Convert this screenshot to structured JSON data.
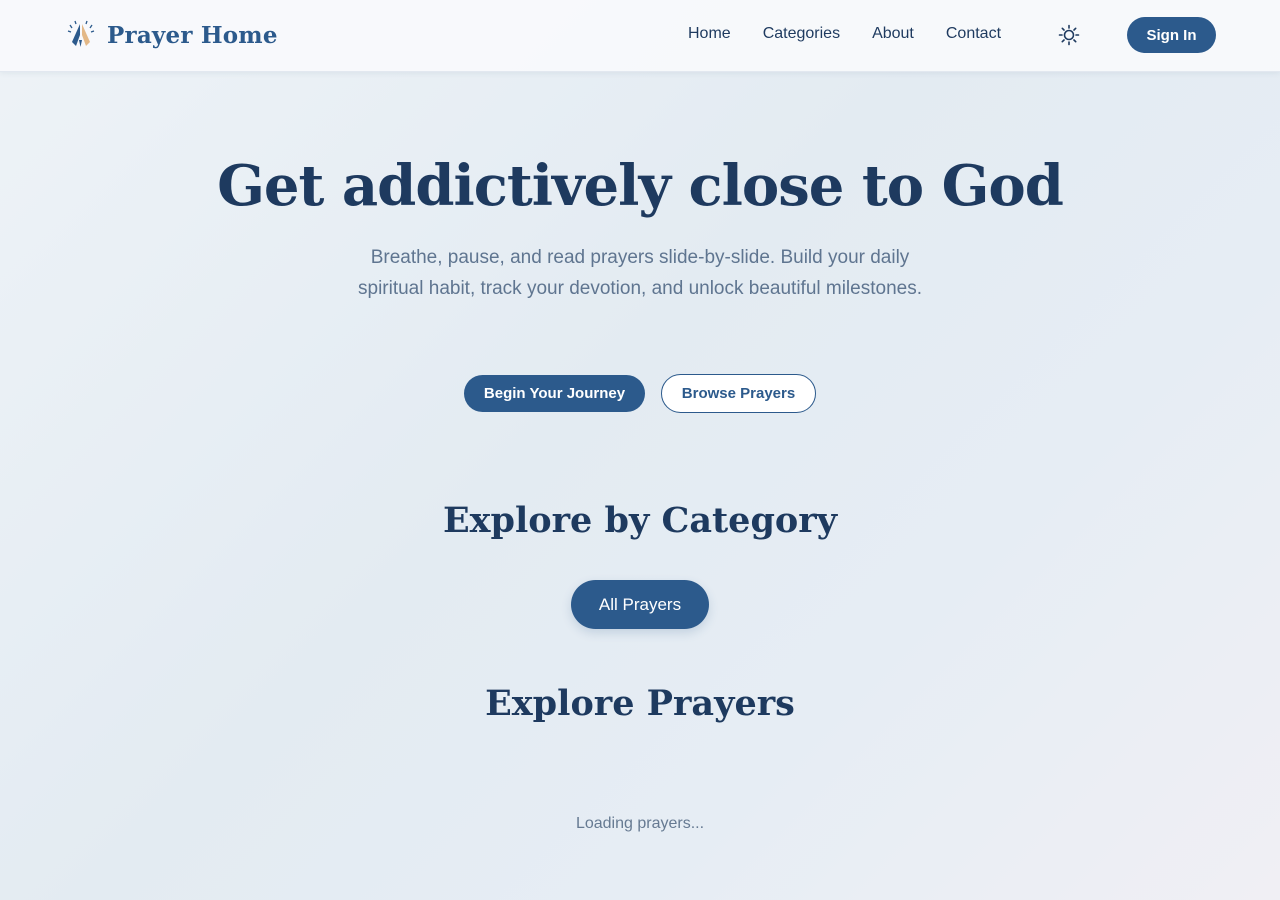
{
  "header": {
    "brand_name": "Prayer Home",
    "brand_icon": "praying-hands-icon",
    "nav": [
      {
        "label": "Home"
      },
      {
        "label": "Categories"
      },
      {
        "label": "About"
      },
      {
        "label": "Contact"
      }
    ],
    "theme_icon": "sun-icon",
    "sign_in_label": "Sign In"
  },
  "hero": {
    "title": "Get addictively close to God",
    "subtitle": "Breathe, pause, and read prayers slide-by-slide. Build your daily spiritual habit, track your devotion, and unlock beautiful milestones.",
    "primary_cta": "Begin Your Journey",
    "secondary_cta": "Browse Prayers"
  },
  "categories": {
    "title": "Explore by Category",
    "items": [
      {
        "label": "All Prayers",
        "active": true
      }
    ]
  },
  "prayers": {
    "title": "Explore Prayers",
    "loading_text": "Loading prayers..."
  },
  "colors": {
    "primary": "#2c5a8c",
    "heading": "#1e3a5f",
    "muted": "#5f7590",
    "hand_left": "#2c5a8c",
    "hand_right": "#e3b887"
  }
}
